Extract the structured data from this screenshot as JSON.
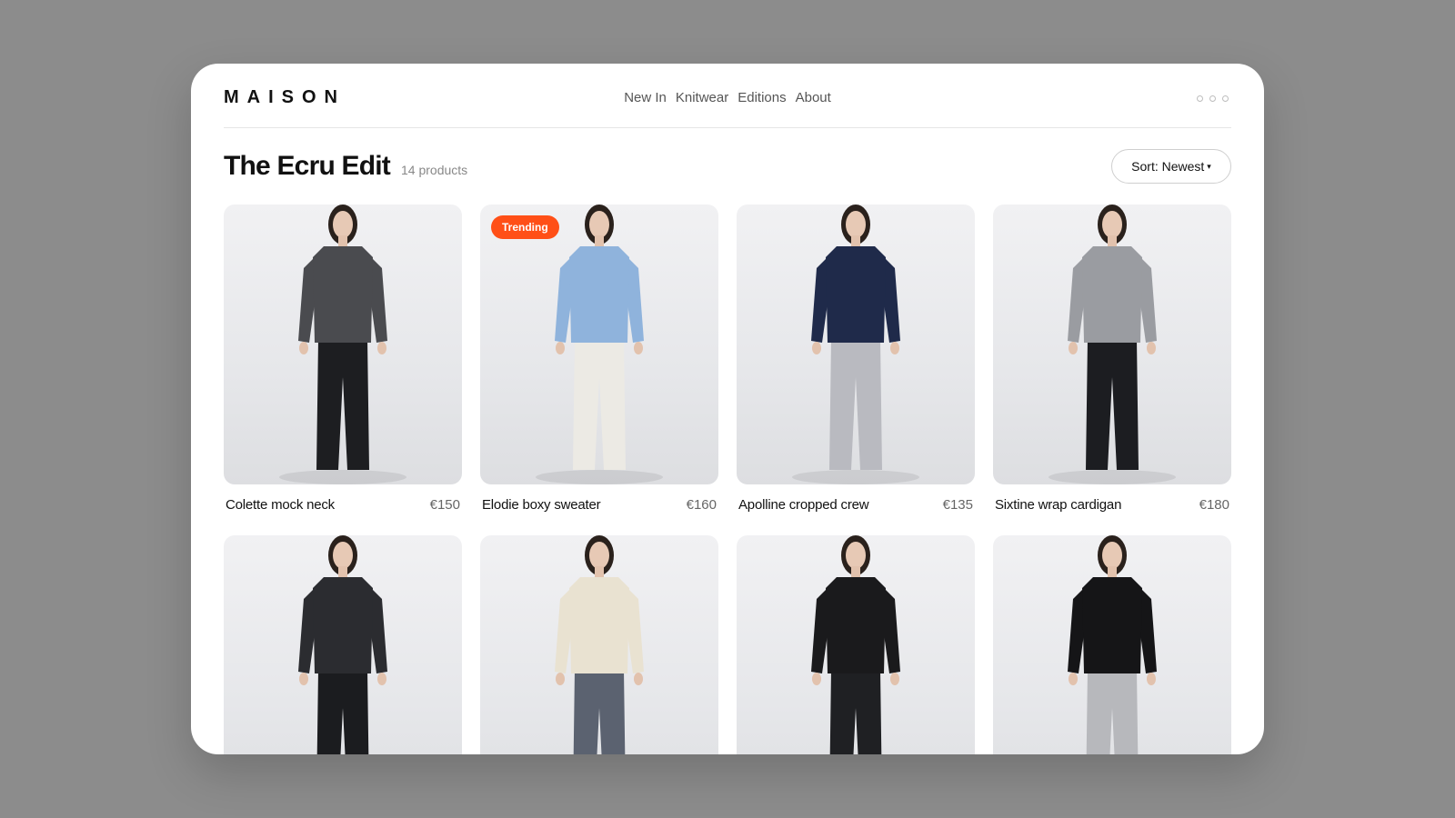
{
  "brand": "MAISON",
  "nav": [
    "New In",
    "Knitwear",
    "Editions",
    "About"
  ],
  "page": {
    "title": "The Ecru Edit",
    "count": "14 products",
    "sort_label": "Sort: Newest"
  },
  "products": [
    {
      "name": "Colette mock neck",
      "price": "€150",
      "badge": "",
      "top": "#4a4b4f",
      "bottom": "#1d1e21"
    },
    {
      "name": "Elodie boxy sweater",
      "price": "€160",
      "badge": "Trending",
      "top": "#8fb3dc",
      "bottom": "#eceae4"
    },
    {
      "name": "Apolline cropped crew",
      "price": "€135",
      "badge": "",
      "top": "#1f2a4a",
      "bottom": "#b9bac0"
    },
    {
      "name": "Sixtine wrap cardigan",
      "price": "€180",
      "badge": "",
      "top": "#9a9ca1",
      "bottom": "#1c1d21"
    },
    {
      "name": "",
      "price": "",
      "badge": "",
      "top": "#2b2c30",
      "bottom": "#1b1c1f"
    },
    {
      "name": "",
      "price": "",
      "badge": "",
      "top": "#e9e2d1",
      "bottom": "#5b6270"
    },
    {
      "name": "",
      "price": "",
      "badge": "",
      "top": "#1a1a1c",
      "bottom": "#1f2023"
    },
    {
      "name": "",
      "price": "",
      "badge": "",
      "top": "#151517",
      "bottom": "#b7b8bc"
    }
  ]
}
